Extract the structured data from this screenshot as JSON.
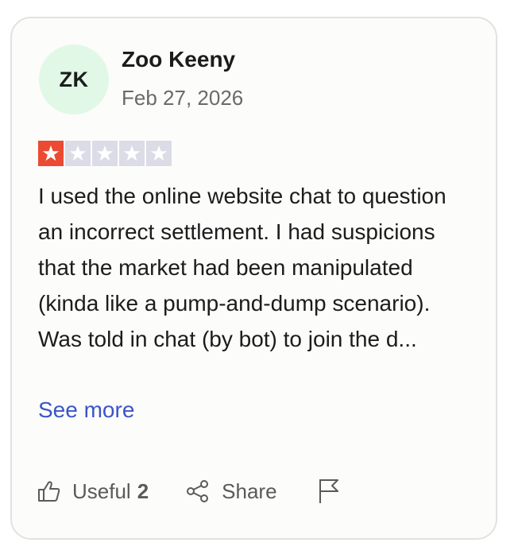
{
  "review": {
    "avatar_initials": "ZK",
    "avatar_bg": "#e1f8e6",
    "author_name": "Zoo Keeny",
    "date": "Feb 27, 2026",
    "rating": 1,
    "rating_max": 5,
    "star_active_color": "#eb4b32",
    "star_inactive_color": "#dcdce6",
    "text": "I used the online website chat to question an incorrect settlement. I had suspicions that the market had been manipulated (kinda like a pump-and-dump scenario). Was told in chat (by bot) to join the d...",
    "see_more_label": "See more",
    "link_color": "#3c54c8"
  },
  "actions": {
    "useful_label": "Useful",
    "useful_count": "2",
    "share_label": "Share",
    "useful_icon": "thumbs-up-icon",
    "share_icon": "share-icon",
    "flag_icon": "flag-icon"
  }
}
